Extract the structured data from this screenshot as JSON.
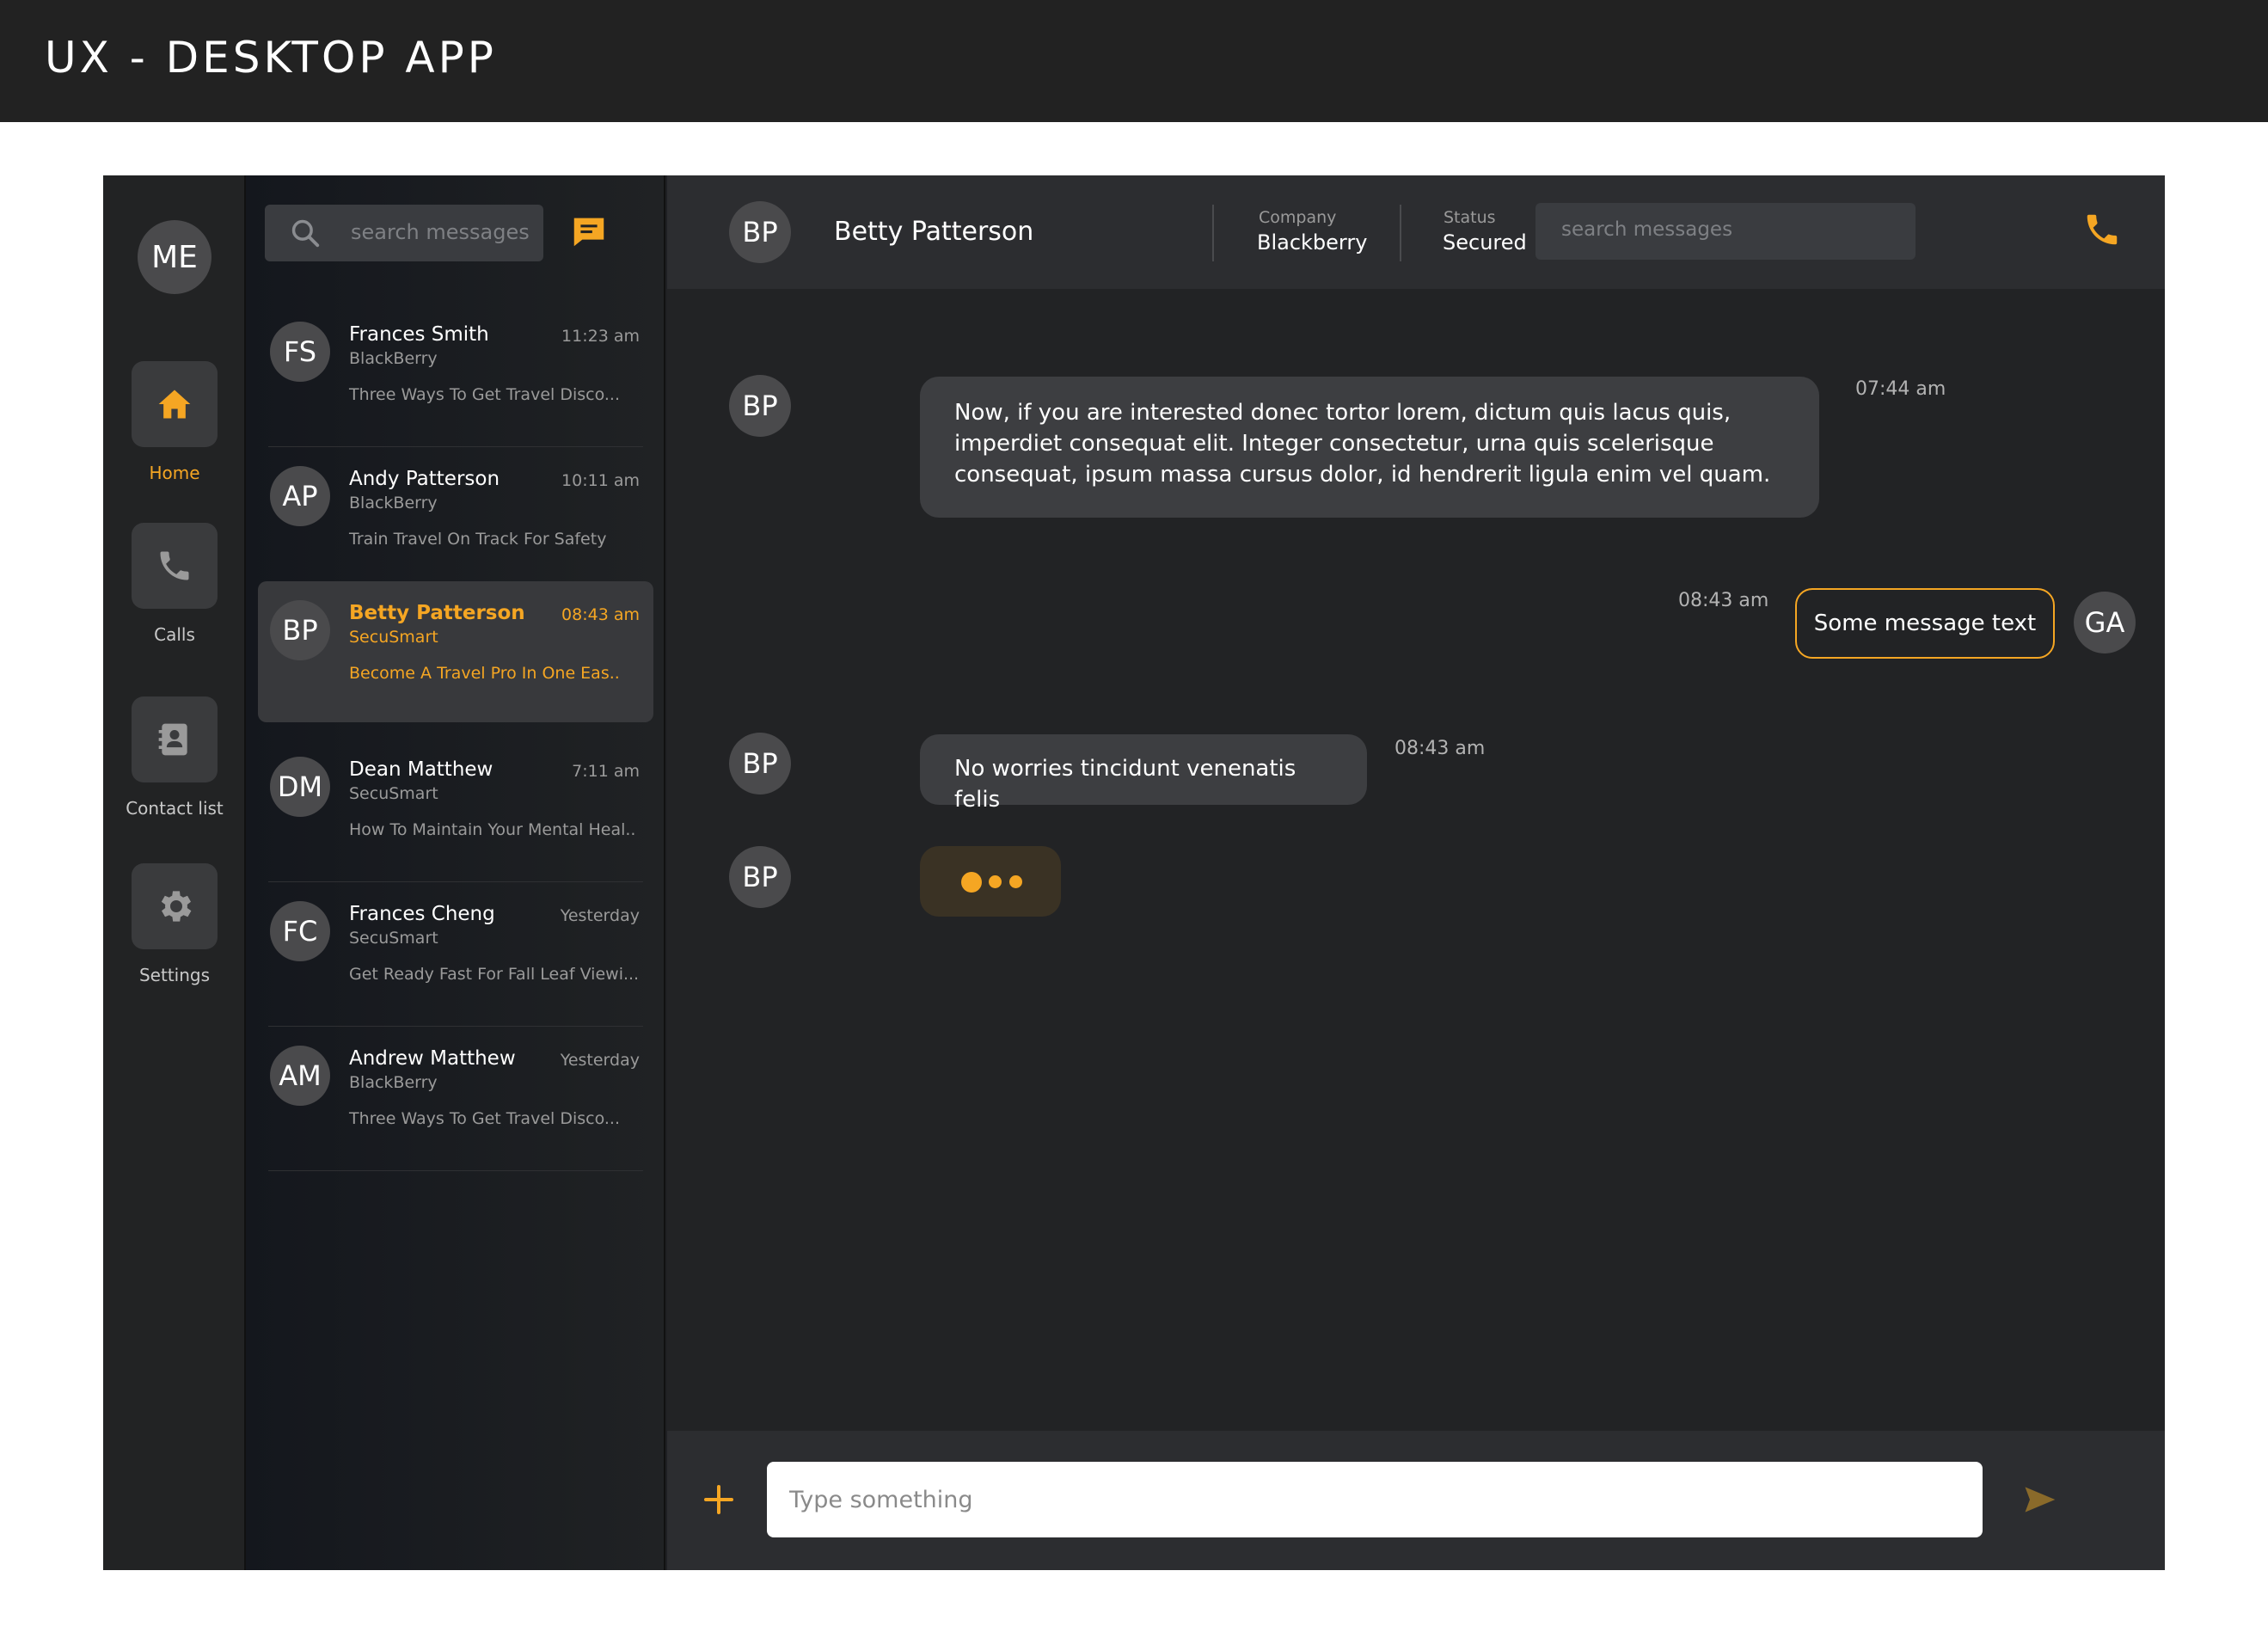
{
  "page": {
    "title": "UX - DESKTOP APP"
  },
  "nav": {
    "me": "ME",
    "items": [
      {
        "label": "Home",
        "icon": "home-icon"
      },
      {
        "label": "Calls",
        "icon": "phone-icon"
      },
      {
        "label": "Contact list",
        "icon": "contact-book-icon"
      },
      {
        "label": "Settings",
        "icon": "gear-icon"
      }
    ]
  },
  "list": {
    "search_placeholder": "search messages",
    "conversations": [
      {
        "initials": "FS",
        "name": "Frances Smith",
        "company": "BlackBerry",
        "preview": "Three Ways To Get Travel Disco...",
        "time": "11:23 am"
      },
      {
        "initials": "AP",
        "name": "Andy Patterson",
        "company": "BlackBerry",
        "preview": "Train Travel On Track For Safety",
        "time": "10:11 am"
      },
      {
        "initials": "BP",
        "name": "Betty Patterson",
        "company": "SecuSmart",
        "preview": "Become A Travel Pro In One Eas..",
        "time": "08:43 am"
      },
      {
        "initials": "DM",
        "name": "Dean Matthew",
        "company": "SecuSmart",
        "preview": "How To Maintain Your Mental Heal..",
        "time": "7:11 am"
      },
      {
        "initials": "FC",
        "name": "Frances Cheng",
        "company": "SecuSmart",
        "preview": "Get Ready Fast For Fall Leaf Viewi...",
        "time": "Yesterday"
      },
      {
        "initials": "AM",
        "name": "Andrew Matthew",
        "company": "BlackBerry",
        "preview": "Three Ways To Get Travel Disco...",
        "time": "Yesterday"
      }
    ]
  },
  "chat": {
    "header": {
      "initials": "BP",
      "name": "Betty Patterson",
      "company_label": "Company",
      "company_value": "Blackberry",
      "status_label": "Status",
      "status_value": "Secured",
      "search_placeholder": "search messages"
    },
    "messages": [
      {
        "initials": "BP",
        "text": "Now, if you are interested donec tortor lorem, dictum quis lacus quis, imperdiet consequat elit. Integer consectetur, urna quis scelerisque consequat, ipsum massa cursus dolor, id hendrerit ligula enim vel quam.",
        "time": "07:44 am"
      },
      {
        "initials": "GA",
        "text": "Some message text",
        "time": "08:43 am"
      },
      {
        "initials": "BP",
        "text": "No worries tincidunt venenatis felis",
        "time": "08:43 am"
      },
      {
        "initials": "BP"
      }
    ],
    "composer": {
      "placeholder": "Type something"
    }
  },
  "colors": {
    "accent": "#f5a623",
    "background": "#222325",
    "bubble": "#3d3e41"
  }
}
